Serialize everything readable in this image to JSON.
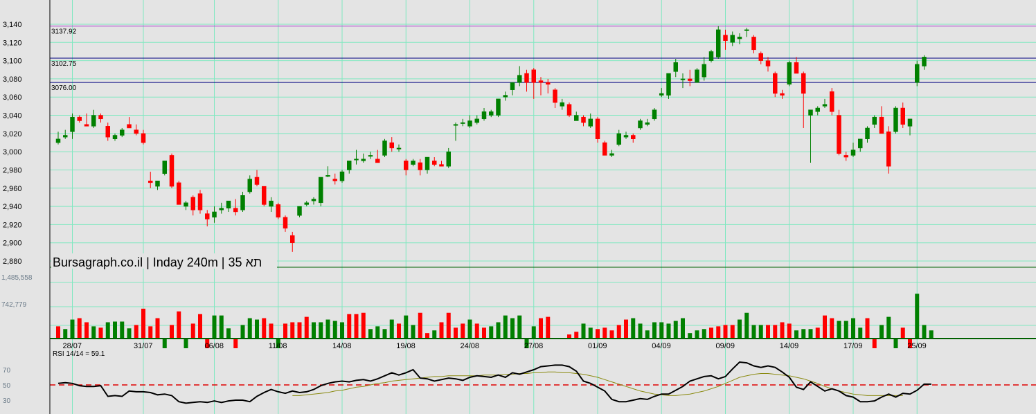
{
  "chart_data": {
    "type": "candlestick",
    "title": "Bursagraph.co.il | Inday 240m | תא 35",
    "price_axis": {
      "ylim": [
        2870,
        3150
      ],
      "ticks": [
        3140,
        3120,
        3100,
        3080,
        3060,
        3040,
        3020,
        3000,
        2980,
        2960,
        2940,
        2920,
        2900,
        2880
      ],
      "tick_labels": [
        "3,140",
        "3,120",
        "3,100",
        "3,080",
        "3,060",
        "3,040",
        "3,020",
        "3,000",
        "2,980",
        "2,960",
        "2,940",
        "2,920",
        "2,900",
        "2,880"
      ]
    },
    "levels": [
      {
        "value": 3137.92,
        "label": "3137.92",
        "color": "#b040d0"
      },
      {
        "value": 3102.75,
        "label": "3102.75",
        "color": "#000080"
      },
      {
        "value": 3076.0,
        "label": "3076.00",
        "color": "#000080"
      }
    ],
    "dates": [
      {
        "label": "28/07",
        "index": 2
      },
      {
        "label": "31/07",
        "index": 12
      },
      {
        "label": "06/08",
        "index": 22
      },
      {
        "label": "11/08",
        "index": 31
      },
      {
        "label": "14/08",
        "index": 40
      },
      {
        "label": "19/08",
        "index": 49
      },
      {
        "label": "24/08",
        "index": 58
      },
      {
        "label": "27/08",
        "index": 67
      },
      {
        "label": "01/09",
        "index": 76
      },
      {
        "label": "04/09",
        "index": 85
      },
      {
        "label": "09/09",
        "index": 94
      },
      {
        "label": "14/09",
        "index": 103
      },
      {
        "label": "17/09",
        "index": 112
      },
      {
        "label": "25/09",
        "index": 121
      }
    ],
    "candles": [
      [
        3010,
        3022,
        3008,
        3014
      ],
      [
        3016,
        3024,
        3014,
        3018
      ],
      [
        3022,
        3042,
        3014,
        3038
      ],
      [
        3038,
        3040,
        3032,
        3034
      ],
      [
        3030,
        3042,
        3028,
        3028
      ],
      [
        3028,
        3046,
        3026,
        3040
      ],
      [
        3040,
        3042,
        3032,
        3036
      ],
      [
        3028,
        3032,
        3012,
        3016
      ],
      [
        3014,
        3020,
        3012,
        3018
      ],
      [
        3018,
        3026,
        3016,
        3024
      ],
      [
        3030,
        3038,
        3026,
        3026
      ],
      [
        3024,
        3030,
        3018,
        3020
      ],
      [
        3020,
        3024,
        3008,
        3010
      ],
      [
        2968,
        2978,
        2960,
        2966
      ],
      [
        2962,
        2968,
        2958,
        2968
      ],
      [
        2976,
        2990,
        2974,
        2990
      ],
      [
        2996,
        2998,
        2960,
        2962
      ],
      [
        2966,
        2968,
        2942,
        2942
      ],
      [
        2940,
        2946,
        2936,
        2944
      ],
      [
        2950,
        2952,
        2930,
        2936
      ],
      [
        2954,
        2958,
        2932,
        2936
      ],
      [
        2932,
        2936,
        2918,
        2926
      ],
      [
        2928,
        2940,
        2922,
        2934
      ],
      [
        2936,
        2944,
        2932,
        2938
      ],
      [
        2938,
        2946,
        2934,
        2946
      ],
      [
        2938,
        2948,
        2930,
        2934
      ],
      [
        2936,
        2956,
        2934,
        2952
      ],
      [
        2956,
        2974,
        2954,
        2970
      ],
      [
        2972,
        2980,
        2962,
        2964
      ],
      [
        2962,
        2962,
        2940,
        2942
      ],
      [
        2940,
        2950,
        2934,
        2946
      ],
      [
        2942,
        2944,
        2926,
        2928
      ],
      [
        2928,
        2930,
        2912,
        2916
      ],
      [
        2908,
        2912,
        2890,
        2900
      ],
      [
        2930,
        2940,
        2928,
        2940
      ],
      [
        2942,
        2946,
        2940,
        2944
      ],
      [
        2946,
        2950,
        2942,
        2948
      ],
      [
        2944,
        2972,
        2940,
        2972
      ],
      [
        2974,
        2984,
        2972,
        2974
      ],
      [
        2970,
        2976,
        2964,
        2968
      ],
      [
        2968,
        2980,
        2966,
        2978
      ],
      [
        2980,
        2990,
        2976,
        2990
      ],
      [
        2992,
        3002,
        2986,
        2992
      ],
      [
        2990,
        2998,
        2988,
        2992
      ],
      [
        2996,
        3000,
        2992,
        2996
      ],
      [
        2992,
        3002,
        2988,
        2988
      ],
      [
        2996,
        3014,
        2994,
        3012
      ],
      [
        3010,
        3016,
        3000,
        3004
      ],
      [
        3004,
        3008,
        3000,
        3004
      ],
      [
        2990,
        2992,
        2974,
        2980
      ],
      [
        2986,
        2992,
        2984,
        2990
      ],
      [
        2988,
        2992,
        2974,
        2980
      ],
      [
        2980,
        2994,
        2976,
        2994
      ],
      [
        2990,
        2994,
        2984,
        2986
      ],
      [
        2986,
        2990,
        2984,
        2984
      ],
      [
        2984,
        3004,
        2982,
        3000
      ],
      [
        3030,
        3032,
        3012,
        3030
      ],
      [
        3032,
        3036,
        3028,
        3032
      ],
      [
        3028,
        3040,
        3026,
        3034
      ],
      [
        3032,
        3040,
        3030,
        3036
      ],
      [
        3036,
        3048,
        3034,
        3044
      ],
      [
        3040,
        3046,
        3038,
        3044
      ],
      [
        3040,
        3058,
        3038,
        3058
      ],
      [
        3060,
        3066,
        3056,
        3062
      ],
      [
        3068,
        3076,
        3062,
        3076
      ],
      [
        3076,
        3094,
        3072,
        3084
      ],
      [
        3086,
        3090,
        3066,
        3076
      ],
      [
        3090,
        3092,
        3058,
        3076
      ],
      [
        3078,
        3082,
        3062,
        3076
      ],
      [
        3076,
        3080,
        3064,
        3074
      ],
      [
        3068,
        3070,
        3048,
        3054
      ],
      [
        3050,
        3058,
        3046,
        3054
      ],
      [
        3052,
        3054,
        3038,
        3040
      ],
      [
        3034,
        3044,
        3034,
        3040
      ],
      [
        3038,
        3040,
        3028,
        3032
      ],
      [
        3028,
        3042,
        3026,
        3036
      ],
      [
        3036,
        3038,
        3010,
        3014
      ],
      [
        3010,
        3012,
        2996,
        2996
      ],
      [
        2996,
        3002,
        2994,
        2998
      ],
      [
        3008,
        3024,
        3006,
        3020
      ],
      [
        3016,
        3022,
        3014,
        3018
      ],
      [
        3018,
        3020,
        3010,
        3014
      ],
      [
        3026,
        3036,
        3024,
        3034
      ],
      [
        3030,
        3036,
        3028,
        3032
      ],
      [
        3036,
        3048,
        3034,
        3046
      ],
      [
        3062,
        3070,
        3060,
        3064
      ],
      [
        3062,
        3084,
        3058,
        3086
      ],
      [
        3088,
        3102,
        3082,
        3098
      ],
      [
        3080,
        3086,
        3070,
        3080
      ],
      [
        3080,
        3090,
        3072,
        3078
      ],
      [
        3076,
        3092,
        3076,
        3090
      ],
      [
        3082,
        3104,
        3078,
        3096
      ],
      [
        3100,
        3112,
        3098,
        3110
      ],
      [
        3104,
        3138,
        3102,
        3134
      ],
      [
        3128,
        3134,
        3112,
        3122
      ],
      [
        3120,
        3132,
        3116,
        3128
      ],
      [
        3124,
        3130,
        3118,
        3126
      ],
      [
        3134,
        3136,
        3126,
        3134
      ],
      [
        3126,
        3128,
        3108,
        3112
      ],
      [
        3108,
        3110,
        3096,
        3100
      ],
      [
        3100,
        3104,
        3088,
        3094
      ],
      [
        3086,
        3088,
        3060,
        3064
      ],
      [
        3064,
        3068,
        3058,
        3062
      ],
      [
        3074,
        3100,
        3072,
        3098
      ],
      [
        3098,
        3104,
        3086,
        3086
      ],
      [
        3086,
        3088,
        3026,
        3064
      ],
      [
        3040,
        3044,
        2988,
        3046
      ],
      [
        3044,
        3050,
        3040,
        3048
      ],
      [
        3050,
        3058,
        3048,
        3052
      ],
      [
        3066,
        3070,
        3040,
        3044
      ],
      [
        3040,
        3046,
        2996,
        2998
      ],
      [
        2996,
        3000,
        2990,
        2994
      ],
      [
        2996,
        3010,
        2994,
        3002
      ],
      [
        3004,
        3014,
        3000,
        3014
      ],
      [
        3014,
        3028,
        3010,
        3026
      ],
      [
        3030,
        3040,
        3026,
        3038
      ],
      [
        3038,
        3050,
        3030,
        3020
      ],
      [
        3022,
        3028,
        2976,
        2984
      ],
      [
        3022,
        3050,
        3020,
        3048
      ],
      [
        3048,
        3054,
        3026,
        3030
      ],
      [
        3028,
        3036,
        3018,
        3036
      ],
      [
        3076,
        3100,
        3072,
        3096
      ],
      [
        3094,
        3106,
        3090,
        3104
      ]
    ],
    "volume_axis": {
      "ylim": [
        0,
        1485558
      ],
      "ticks": [
        1485558,
        742779
      ],
      "tick_labels": [
        "1,485,558",
        "742,779"
      ]
    },
    "volumes": [
      [
        0.18,
        "r"
      ],
      [
        0.14,
        "g"
      ],
      [
        0.28,
        "g"
      ],
      [
        0.3,
        "r"
      ],
      [
        0.24,
        "r"
      ],
      [
        0.18,
        "g"
      ],
      [
        0.16,
        "r"
      ],
      [
        0.24,
        "g"
      ],
      [
        0.25,
        "g"
      ],
      [
        0.25,
        "g"
      ],
      [
        0.15,
        "g"
      ],
      [
        0.2,
        "r"
      ],
      [
        0.44,
        "r"
      ],
      [
        0.18,
        "r"
      ],
      [
        0.3,
        "r"
      ],
      [
        -0.1,
        "g"
      ],
      [
        0.2,
        "r"
      ],
      [
        0.4,
        "r"
      ],
      [
        -0.1,
        "g"
      ],
      [
        0.22,
        "r"
      ],
      [
        0.36,
        "r"
      ],
      [
        -0.1,
        "r"
      ],
      [
        0.34,
        "g"
      ],
      [
        0.34,
        "g"
      ],
      [
        0.15,
        "g"
      ],
      [
        -0.1,
        "r"
      ],
      [
        0.2,
        "g"
      ],
      [
        0.3,
        "g"
      ],
      [
        0.28,
        "g"
      ],
      [
        0.3,
        "r"
      ],
      [
        0.22,
        "r"
      ],
      [
        -0.1,
        "g"
      ],
      [
        0.22,
        "r"
      ],
      [
        0.24,
        "r"
      ],
      [
        0.24,
        "r"
      ],
      [
        0.32,
        "r"
      ],
      [
        0.24,
        "g"
      ],
      [
        0.24,
        "g"
      ],
      [
        0.28,
        "g"
      ],
      [
        0.26,
        "g"
      ],
      [
        0.24,
        "g"
      ],
      [
        0.36,
        "r"
      ],
      [
        0.36,
        "r"
      ],
      [
        0.38,
        "r"
      ],
      [
        0.14,
        "g"
      ],
      [
        0.18,
        "g"
      ],
      [
        0.14,
        "g"
      ],
      [
        0.28,
        "g"
      ],
      [
        0.22,
        "r"
      ],
      [
        0.34,
        "g"
      ],
      [
        0.2,
        "g"
      ],
      [
        0.38,
        "r"
      ],
      [
        0.08,
        "r"
      ],
      [
        0.12,
        "g"
      ],
      [
        0.24,
        "r"
      ],
      [
        0.38,
        "r"
      ],
      [
        0.16,
        "r"
      ],
      [
        0.22,
        "r"
      ],
      [
        0.28,
        "g"
      ],
      [
        0.22,
        "r"
      ],
      [
        0.16,
        "r"
      ],
      [
        0.18,
        "g"
      ],
      [
        0.24,
        "g"
      ],
      [
        0.34,
        "g"
      ],
      [
        0.3,
        "g"
      ],
      [
        0.34,
        "g"
      ],
      [
        -0.1,
        "g"
      ],
      [
        0.18,
        "g"
      ],
      [
        0.3,
        "r"
      ],
      [
        0.32,
        "r"
      ],
      [
        0.0,
        "r"
      ],
      [
        0.0,
        "r"
      ],
      [
        0.06,
        "r"
      ],
      [
        0.1,
        "r"
      ],
      [
        0.22,
        "g"
      ],
      [
        0.16,
        "g"
      ],
      [
        0.14,
        "r"
      ],
      [
        0.16,
        "r"
      ],
      [
        0.12,
        "r"
      ],
      [
        0.2,
        "r"
      ],
      [
        0.28,
        "r"
      ],
      [
        0.3,
        "g"
      ],
      [
        0.22,
        "g"
      ],
      [
        0.12,
        "g"
      ],
      [
        0.24,
        "g"
      ],
      [
        0.24,
        "g"
      ],
      [
        0.22,
        "g"
      ],
      [
        0.26,
        "g"
      ],
      [
        0.3,
        "g"
      ],
      [
        0.08,
        "g"
      ],
      [
        0.12,
        "g"
      ],
      [
        0.14,
        "g"
      ],
      [
        0.16,
        "r"
      ],
      [
        0.18,
        "r"
      ],
      [
        0.2,
        "r"
      ],
      [
        0.2,
        "r"
      ],
      [
        0.28,
        "g"
      ],
      [
        0.38,
        "g"
      ],
      [
        0.2,
        "g"
      ],
      [
        0.2,
        "g"
      ],
      [
        0.2,
        "r"
      ],
      [
        0.2,
        "r"
      ],
      [
        0.24,
        "r"
      ],
      [
        0.22,
        "r"
      ],
      [
        0.12,
        "g"
      ],
      [
        0.14,
        "g"
      ],
      [
        0.14,
        "g"
      ],
      [
        0.16,
        "r"
      ],
      [
        0.34,
        "r"
      ],
      [
        0.3,
        "r"
      ],
      [
        0.26,
        "g"
      ],
      [
        0.26,
        "g"
      ],
      [
        0.3,
        "g"
      ],
      [
        0.16,
        "g"
      ],
      [
        0.3,
        "r"
      ],
      [
        -0.1,
        "r"
      ],
      [
        0.2,
        "g"
      ],
      [
        0.32,
        "g"
      ],
      [
        -0.06,
        "g"
      ],
      [
        0.16,
        "r"
      ],
      [
        -0.1,
        "r"
      ],
      [
        0.66,
        "g"
      ],
      [
        0.2,
        "g"
      ],
      [
        0.12,
        "g"
      ]
    ],
    "rsi": {
      "label": "RSI 14/14 = 59.1",
      "ticks": [
        70,
        50,
        30
      ],
      "tick_labels": [
        "70",
        "50",
        "30"
      ],
      "ylim": [
        20,
        90
      ],
      "reference_level": 50,
      "values": [
        52,
        53,
        52,
        49,
        48,
        48,
        49,
        35,
        36,
        35,
        42,
        41,
        41,
        40,
        37,
        38,
        36,
        28,
        26,
        27,
        28,
        27,
        29,
        27,
        29,
        30,
        30,
        28,
        35,
        40,
        44,
        41,
        39,
        42,
        40,
        41,
        44,
        49,
        52,
        54,
        55,
        54,
        56,
        57,
        55,
        58,
        62,
        66,
        63,
        66,
        70,
        59,
        58,
        55,
        57,
        59,
        58,
        56,
        60,
        62,
        61,
        60,
        63,
        60,
        66,
        64,
        67,
        70,
        74,
        75,
        76,
        76,
        74,
        68,
        55,
        52,
        47,
        42,
        31,
        28,
        28,
        30,
        32,
        31,
        35,
        38,
        38,
        43,
        48,
        55,
        58,
        61,
        62,
        58,
        61,
        71,
        80,
        79,
        75,
        73,
        75,
        73,
        67,
        60,
        47,
        44,
        54,
        48,
        42,
        45,
        42,
        36,
        34,
        28,
        28,
        29,
        34,
        38,
        34,
        39,
        38,
        43,
        51,
        51
      ],
      "signal": [
        null,
        null,
        null,
        null,
        null,
        null,
        null,
        null,
        null,
        null,
        null,
        null,
        null,
        null,
        null,
        null,
        null,
        null,
        null,
        null,
        null,
        null,
        null,
        null,
        null,
        null,
        null,
        null,
        null,
        null,
        null,
        null,
        null,
        36,
        36,
        37,
        38,
        39,
        40,
        42,
        43,
        45,
        47,
        48,
        50,
        52,
        53,
        55,
        56,
        57,
        58,
        59,
        60,
        61,
        61,
        62,
        62,
        62,
        62,
        62,
        63,
        63,
        63,
        64,
        64,
        65,
        65,
        66,
        66,
        67,
        67,
        66,
        66,
        65,
        64,
        62,
        60,
        57,
        54,
        51,
        48,
        45,
        42,
        40,
        38,
        37,
        36,
        36,
        37,
        38,
        40,
        42,
        45,
        48,
        52,
        56,
        60,
        62,
        64,
        65,
        65,
        64,
        63,
        62,
        60,
        58,
        55,
        52,
        48,
        45,
        42,
        40,
        38,
        37,
        36,
        36,
        36,
        36,
        36,
        36
      ]
    }
  }
}
